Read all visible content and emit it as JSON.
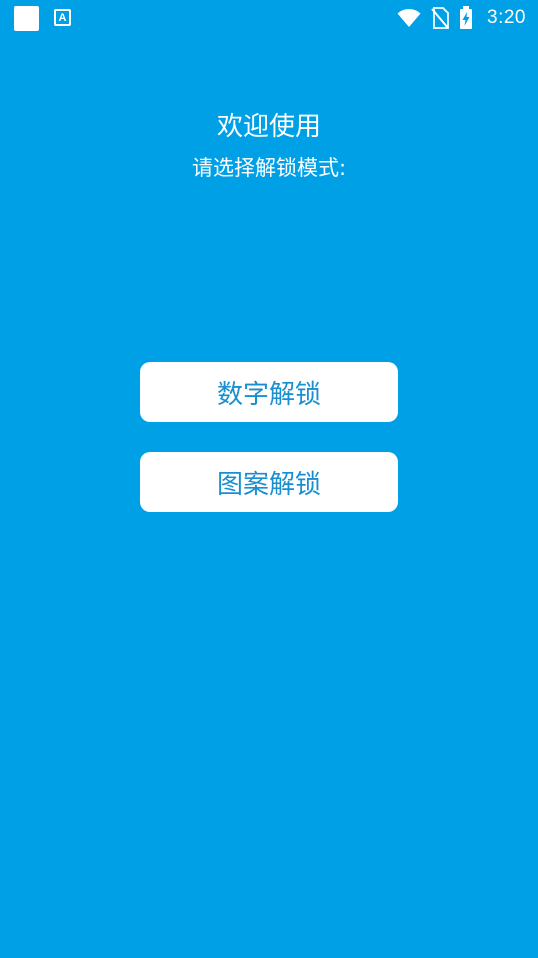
{
  "status_bar": {
    "time": "3:20",
    "notification_icons": [
      "white-square-icon",
      "app-a-icon"
    ],
    "system_icons": [
      "wifi-icon",
      "no-sim-icon",
      "battery-charging-icon"
    ]
  },
  "main": {
    "welcome_text": "欢迎使用",
    "subtitle_text": "请选择解锁模式:",
    "buttons": [
      {
        "label": "数字解锁"
      },
      {
        "label": "图案解锁"
      }
    ]
  },
  "colors": {
    "background": "#00A0E6",
    "button_bg": "#FFFFFF",
    "button_text": "#1A8FD0",
    "text": "#FFFFFF"
  }
}
